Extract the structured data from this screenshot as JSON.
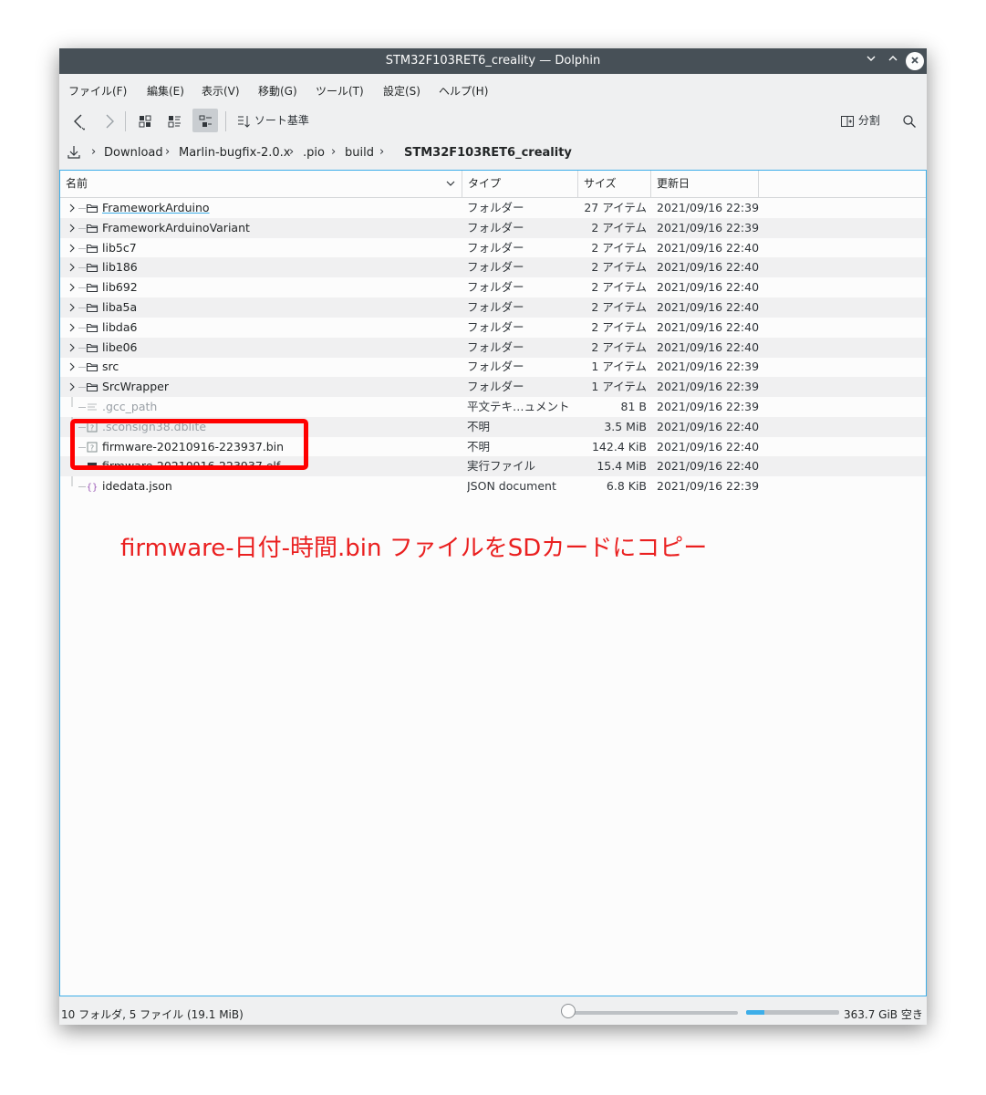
{
  "window": {
    "title": "STM32F103RET6_creality — Dolphin"
  },
  "menu": [
    "ファイル(F)",
    "編集(E)",
    "表示(V)",
    "移動(G)",
    "ツール(T)",
    "設定(S)",
    "ヘルプ(H)"
  ],
  "toolbar": {
    "sort_label": "ソート基準",
    "split_label": "分割"
  },
  "breadcrumb": [
    "Download",
    "Marlin-bugfix-2.0.x",
    ".pio",
    "build",
    "STM32F103RET6_creality"
  ],
  "columns": {
    "name": "名前",
    "type": "タイプ",
    "size": "サイズ",
    "date": "更新日"
  },
  "files": [
    {
      "name": "FrameworkArduino",
      "type": "フォルダー",
      "size": "27 アイテム",
      "date": "2021/09/16 22:39",
      "icon": "folder-icon"
    },
    {
      "name": "FrameworkArduinoVariant",
      "type": "フォルダー",
      "size": "2 アイテム",
      "date": "2021/09/16 22:39",
      "icon": "folder-icon"
    },
    {
      "name": "lib5c7",
      "type": "フォルダー",
      "size": "2 アイテム",
      "date": "2021/09/16 22:40",
      "icon": "folder-icon"
    },
    {
      "name": "lib186",
      "type": "フォルダー",
      "size": "2 アイテム",
      "date": "2021/09/16 22:40",
      "icon": "folder-icon"
    },
    {
      "name": "lib692",
      "type": "フォルダー",
      "size": "2 アイテム",
      "date": "2021/09/16 22:40",
      "icon": "folder-icon"
    },
    {
      "name": "liba5a",
      "type": "フォルダー",
      "size": "2 アイテム",
      "date": "2021/09/16 22:40",
      "icon": "folder-icon"
    },
    {
      "name": "libda6",
      "type": "フォルダー",
      "size": "2 アイテム",
      "date": "2021/09/16 22:40",
      "icon": "folder-icon"
    },
    {
      "name": "libe06",
      "type": "フォルダー",
      "size": "2 アイテム",
      "date": "2021/09/16 22:40",
      "icon": "folder-icon"
    },
    {
      "name": "src",
      "type": "フォルダー",
      "size": "1 アイテム",
      "date": "2021/09/16 22:39",
      "icon": "folder-icon"
    },
    {
      "name": "SrcWrapper",
      "type": "フォルダー",
      "size": "1 アイテム",
      "date": "2021/09/16 22:39",
      "icon": "folder-icon"
    },
    {
      "name": ".gcc_path",
      "type": "平文テキ…ュメント",
      "size": "81 B",
      "date": "2021/09/16 22:39",
      "icon": "text-file-icon"
    },
    {
      "name": ".sconsign38.dblite",
      "type": "不明",
      "size": "3.5 MiB",
      "date": "2021/09/16 22:40",
      "icon": "unknown-file-icon"
    },
    {
      "name": "firmware-20210916-223937.bin",
      "type": "不明",
      "size": "142.4 KiB",
      "date": "2021/09/16 22:40",
      "icon": "unknown-file-icon"
    },
    {
      "name": "firmware-20210916-223937.elf",
      "type": "実行ファイル",
      "size": "15.4 MiB",
      "date": "2021/09/16 22:40",
      "icon": "executable-icon"
    },
    {
      "name": "idedata.json",
      "type": "JSON document",
      "size": "6.8 KiB",
      "date": "2021/09/16 22:39",
      "icon": "json-file-icon"
    }
  ],
  "annotation": {
    "text": "firmware-日付-時間.bin ファイルをSDカードにコピー"
  },
  "status": {
    "summary": "10 フォルダ, 5 ファイル (19.1 MiB)",
    "free_space": "363.7 GiB 空き",
    "zoom_level": 0.0,
    "disk_used_fraction": 0.2
  },
  "colors": {
    "accent": "#3daee9",
    "annotation": "#ff0000",
    "titlebar": "#475057"
  }
}
